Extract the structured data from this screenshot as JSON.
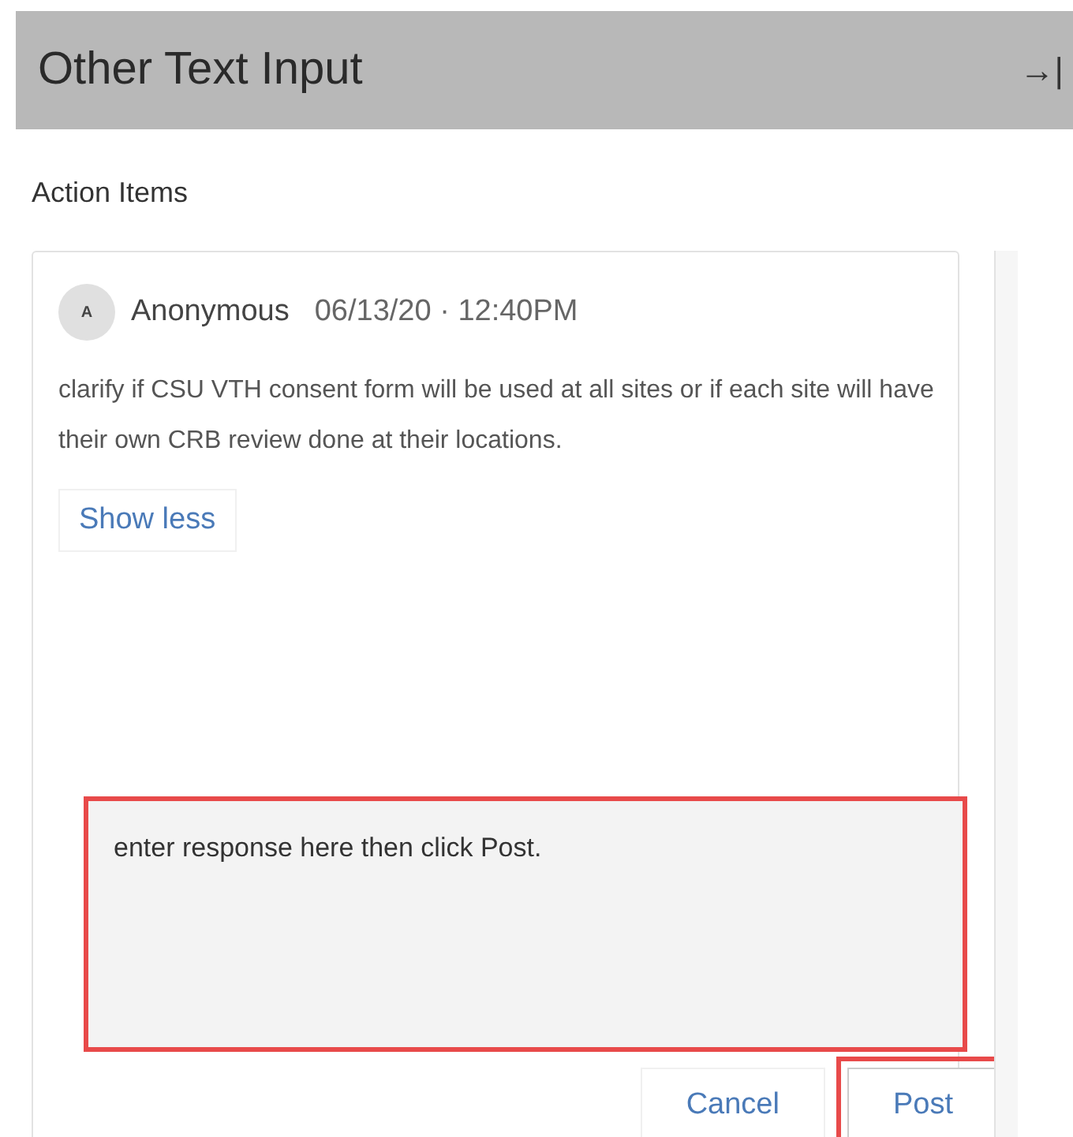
{
  "header": {
    "title": "Other Text Input",
    "collapse_icon": "→|"
  },
  "section_title": "Action Items",
  "comment": {
    "avatar_initial": "A",
    "author": "Anonymous",
    "timestamp": "06/13/20 · 12:40PM",
    "body": "clarify if CSU VTH consent form will be used at all sites or if each site will have their own CRB review done at their locations.",
    "toggle_label": "Show less"
  },
  "response": {
    "placeholder": "enter response here then click Post.",
    "highlighted": true
  },
  "buttons": [
    {
      "label": "Cancel",
      "highlighted": false
    },
    {
      "label": "Post",
      "highlighted": true
    }
  ]
}
